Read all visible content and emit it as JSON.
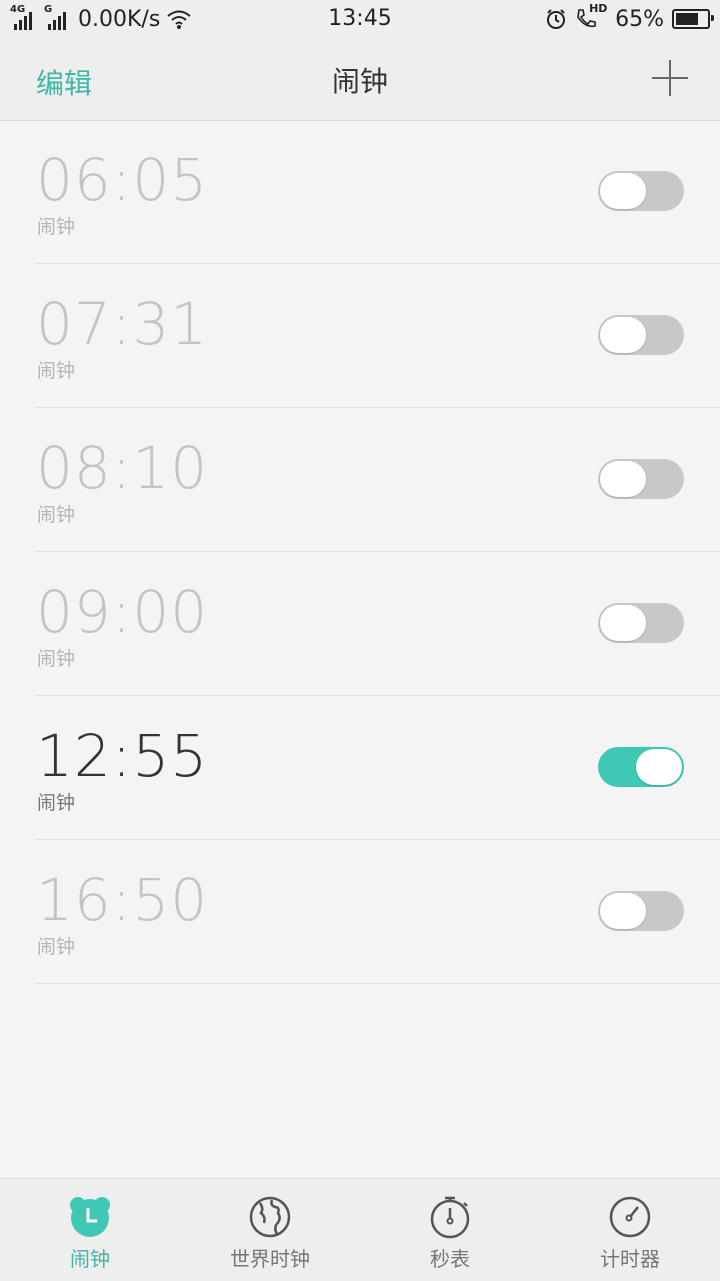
{
  "status_bar": {
    "net1": "4G",
    "net2": "G",
    "speed": "0.00K/s",
    "time": "13:45",
    "hd": "HD",
    "battery": "65%",
    "battery_level": 0.65
  },
  "header": {
    "edit": "编辑",
    "title": "闹钟"
  },
  "alarms": [
    {
      "time": "06:05",
      "label": "闹钟",
      "enabled": false
    },
    {
      "time": "07:31",
      "label": "闹钟",
      "enabled": false
    },
    {
      "time": "08:10",
      "label": "闹钟",
      "enabled": false
    },
    {
      "time": "09:00",
      "label": "闹钟",
      "enabled": false
    },
    {
      "time": "12:55",
      "label": "闹钟",
      "enabled": true
    },
    {
      "time": "16:50",
      "label": "闹钟",
      "enabled": false
    }
  ],
  "tabs": [
    {
      "label": "闹钟",
      "icon": "alarm-clock-icon",
      "active": true
    },
    {
      "label": "世界时钟",
      "icon": "globe-icon",
      "active": false
    },
    {
      "label": "秒表",
      "icon": "stopwatch-icon",
      "active": false
    },
    {
      "label": "计时器",
      "icon": "timer-icon",
      "active": false
    }
  ],
  "colors": {
    "accent": "#3fc8b6",
    "toggle_off": "#c8c8c8"
  }
}
